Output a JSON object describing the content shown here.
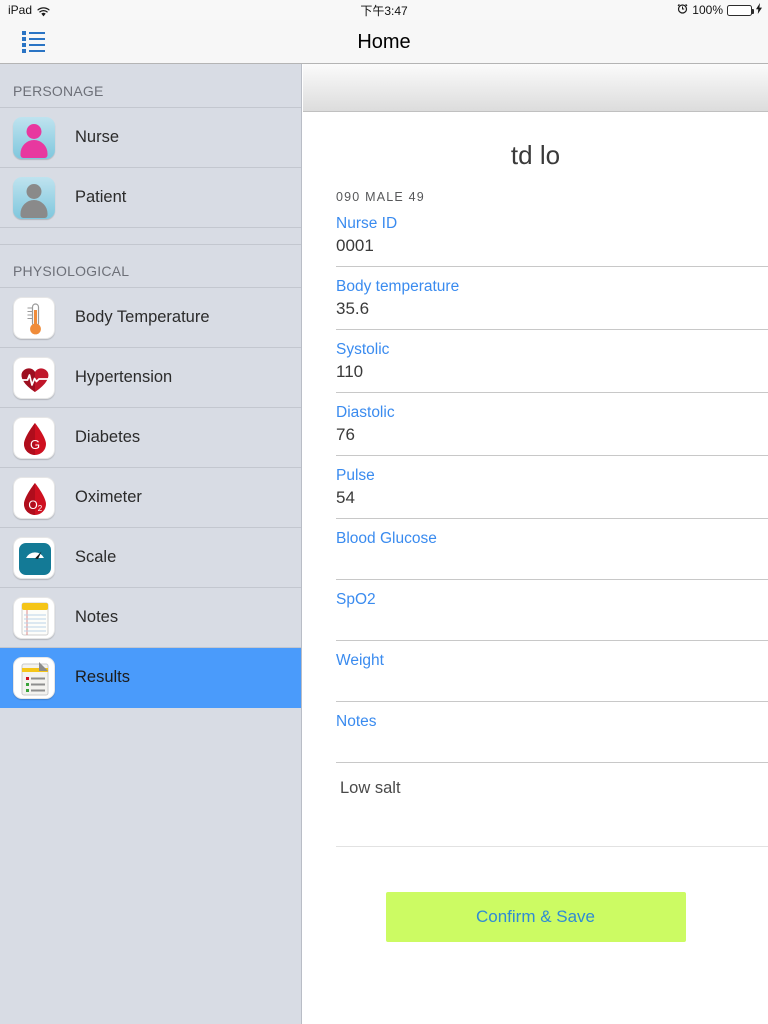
{
  "status_bar": {
    "device": "iPad",
    "wifi_icon": "wifi-icon",
    "time": "下午3:47",
    "alarm_icon": "alarm-clock-icon",
    "battery_percent": "100%",
    "battery_icon": "battery-icon",
    "charging_icon": "lightning-bolt-icon",
    "battery_level": 100,
    "battery_color": "#4cd964"
  },
  "navbar": {
    "title": "Home",
    "list_button_icon": "bulleted-list-icon",
    "list_button_color": "#2a74c4"
  },
  "sidebar": {
    "background_color": "#d8dce4",
    "selected_color": "#4a9bfb",
    "sections": [
      {
        "header": "PERSONAGE",
        "items": [
          {
            "label": "Nurse",
            "icon": "nurse-avatar-icon",
            "selected": false
          },
          {
            "label": "Patient",
            "icon": "patient-avatar-icon",
            "selected": false
          }
        ]
      },
      {
        "header": "PHYSIOLOGICAL",
        "items": [
          {
            "label": "Body Temperature",
            "icon": "thermometer-icon",
            "selected": false
          },
          {
            "label": "Hypertension",
            "icon": "heart-pulse-icon",
            "selected": false
          },
          {
            "label": "Diabetes",
            "icon": "blood-drop-glucose-icon",
            "selected": false
          },
          {
            "label": "Oximeter",
            "icon": "blood-drop-oxygen-icon",
            "selected": false
          },
          {
            "label": "Scale",
            "icon": "weighing-scale-icon",
            "selected": false
          },
          {
            "label": "Notes",
            "icon": "notepad-icon",
            "selected": false
          },
          {
            "label": "Results",
            "icon": "results-clipboard-icon",
            "selected": true
          }
        ]
      }
    ]
  },
  "record": {
    "title": "td lo",
    "subtitle": "090  MALE  49",
    "fields": [
      {
        "label": "Nurse ID",
        "value": "0001"
      },
      {
        "label": "Body temperature",
        "value": "35.6"
      },
      {
        "label": "Systolic",
        "value": "110"
      },
      {
        "label": "Diastolic",
        "value": "76"
      },
      {
        "label": "Pulse",
        "value": "54"
      },
      {
        "label": "Blood Glucose",
        "value": ""
      },
      {
        "label": "SpO2",
        "value": ""
      },
      {
        "label": "Weight",
        "value": ""
      },
      {
        "label": "Notes",
        "value": ""
      }
    ],
    "notes_text": "Low salt",
    "save_button": {
      "label": "Confirm & Save",
      "background_color": "#ccfb63",
      "text_color": "#2f8bd4"
    },
    "label_color": "#3a8bef"
  }
}
